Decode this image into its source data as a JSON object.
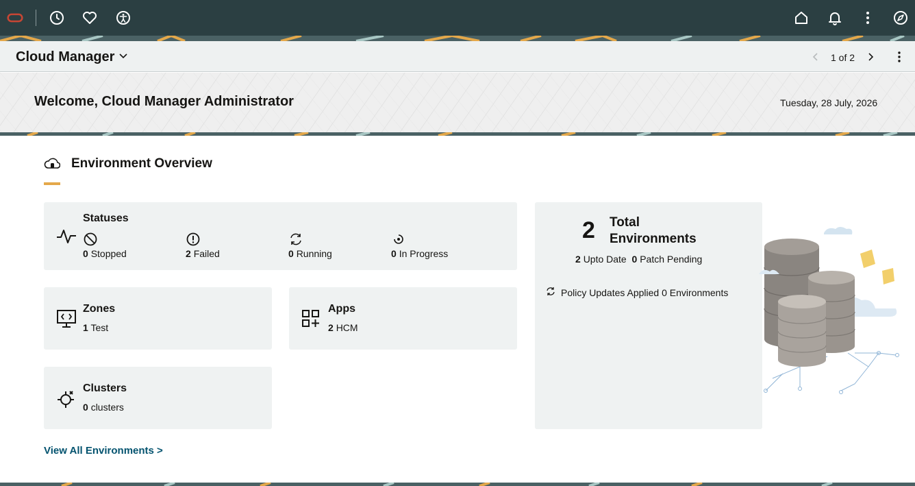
{
  "topbar": {
    "icons": [
      "oracle-logo-icon",
      "recent-history-icon",
      "favorites-heart-icon",
      "accessibility-icon",
      "home-icon",
      "notifications-bell-icon",
      "more-options-icon",
      "navigator-compass-icon"
    ]
  },
  "pagebar": {
    "title": "Cloud Manager",
    "pager": "1 of 2"
  },
  "banner": {
    "welcome": "Welcome, Cloud Manager Administrator",
    "date": "Tuesday, 28 July, 2026"
  },
  "overview": {
    "title": "Environment Overview",
    "accent_color": "#e4a84a"
  },
  "statuses": {
    "label": "Statuses",
    "items": [
      {
        "count": "0",
        "label": "Stopped"
      },
      {
        "count": "2",
        "label": "Failed"
      },
      {
        "count": "0",
        "label": "Running"
      },
      {
        "count": "0",
        "label": "In Progress"
      }
    ]
  },
  "zones": {
    "label": "Zones",
    "count": "1",
    "value": "Test"
  },
  "apps": {
    "label": "Apps",
    "count": "2",
    "value": "HCM"
  },
  "clusters": {
    "label": "Clusters",
    "count": "0",
    "value": "clusters"
  },
  "total": {
    "count": "2",
    "label": "Total Environments",
    "upto_date_count": "2",
    "upto_date_label": "Upto Date",
    "patch_pending_count": "0",
    "patch_pending_label": "Patch Pending",
    "policy_text": "Policy Updates Applied 0 Environments"
  },
  "view_all": "View All Environments >",
  "colors": {
    "topbar_bg": "#2b3f42",
    "card_bg": "#eff2f2",
    "link": "#04536f"
  }
}
